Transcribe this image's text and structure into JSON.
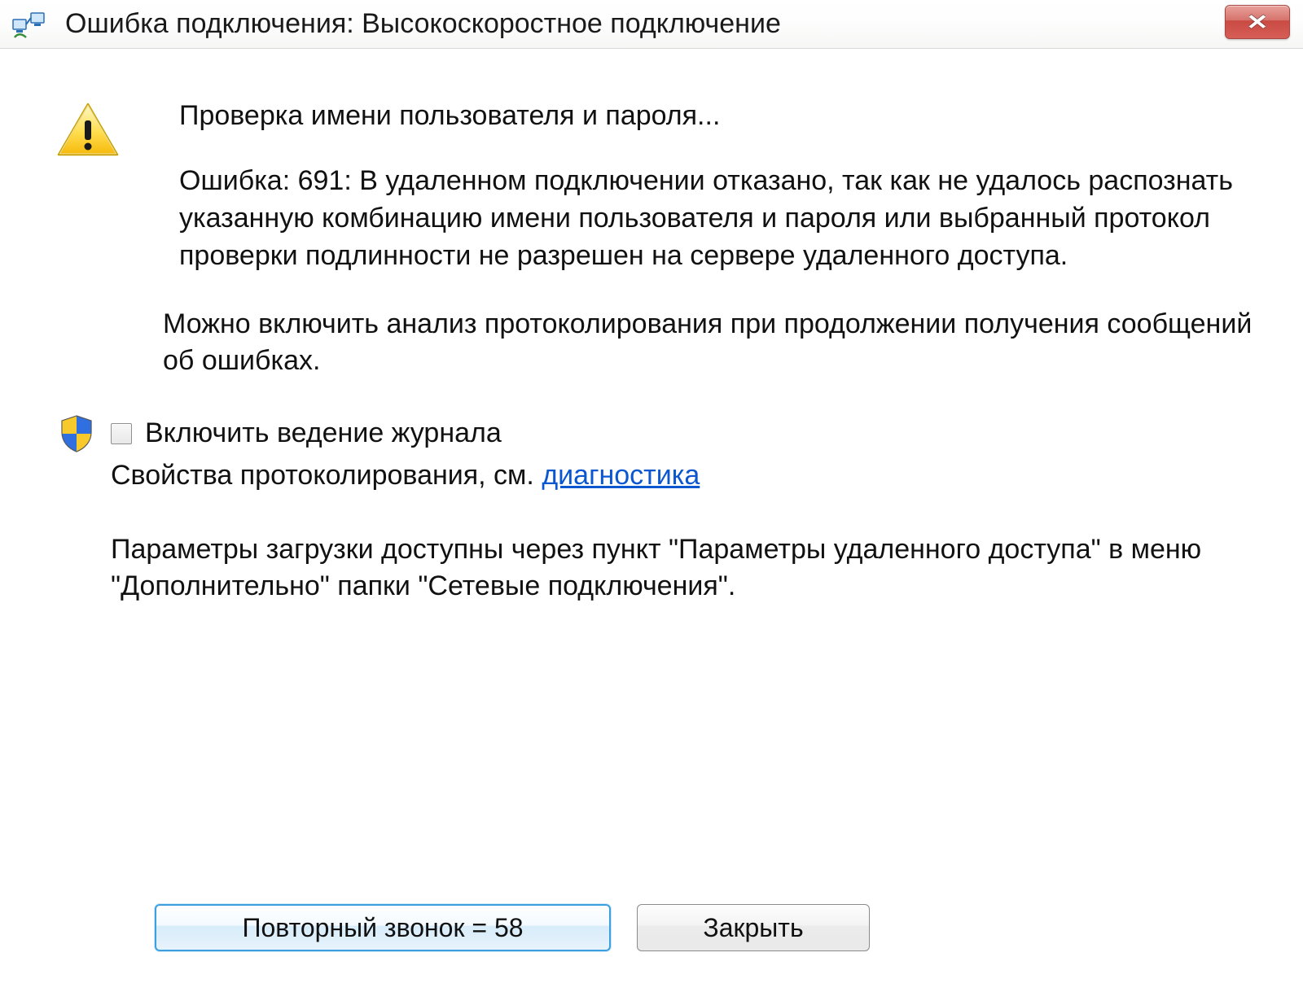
{
  "titlebar": {
    "title": "Ошибка подключения: Высокоскоростное подключение",
    "close_glyph": "✕"
  },
  "body": {
    "status": "Проверка имени пользователя и пароля...",
    "error": "Ошибка: 691: В удаленном подключении отказано, так как не удалось распознать указанную комбинацию имени пользователя и пароля или выбранный протокол проверки подлинности не разрешен на сервере удаленного доступа.",
    "logging_tip": "Можно включить анализ протоколирования при продолжении получения сообщений об ошибках.",
    "checkbox_label": "Включить ведение журнала",
    "props_prefix": "Свойства протоколирования, см. ",
    "props_link": "диагностика",
    "params": "Параметры загрузки доступны через пункт \"Параметры удаленного доступа\" в меню \"Дополнительно\" папки \"Сетевые подключения\"."
  },
  "buttons": {
    "redial": "Повторный звонок = 58",
    "close": "Закрыть"
  }
}
